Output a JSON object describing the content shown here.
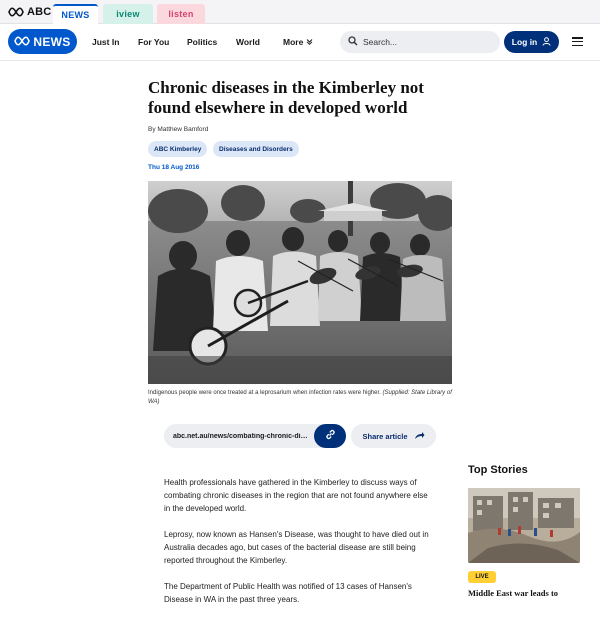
{
  "network": {
    "brand": "ABC",
    "tabs": [
      {
        "label": "NEWS",
        "color": "#0058cc"
      },
      {
        "label": "iview",
        "color": "#0a8a74"
      },
      {
        "label": "listen",
        "color": "#d6456a"
      }
    ]
  },
  "nav": {
    "logo_text": "NEWS",
    "items": [
      "Just In",
      "For You",
      "Politics",
      "World",
      "More"
    ],
    "search_placeholder": "Search...",
    "login_label": "Log in"
  },
  "article": {
    "headline": "Chronic diseases in the Kimberley not found elsewhere in developed world",
    "byline": "By Matthew Bamford",
    "tags": [
      "ABC Kimberley",
      "Diseases and Disorders"
    ],
    "date": "Thu 18 Aug 2016",
    "caption_text": "Indigenous people were once treated at a leprosarium when infection rates were higher.",
    "caption_credit": "(Supplied: State Library of WA)",
    "share_url": "abc.net.au/news/combating-chronic-diseases",
    "share_label": "Share article",
    "paragraphs": [
      "Health professionals have gathered in the Kimberley to discuss ways of combating chronic diseases in the region that are not found anywhere else in the developed world.",
      "Leprosy, now known as Hansen's Disease, was thought to have died out in Australia decades ago, but cases of the bacterial disease are still being reported throughout the Kimberley.",
      "The Department of Public Health was notified of 13 cases of Hansen's Disease in WA in the past three years."
    ]
  },
  "top_stories": {
    "title": "Top Stories",
    "items": [
      {
        "badge": "LIVE",
        "headline": "Middle East war leads to"
      }
    ]
  },
  "colors": {
    "accent": "#0058cc",
    "dark_accent": "#00307a",
    "live": "#ffcf33"
  }
}
